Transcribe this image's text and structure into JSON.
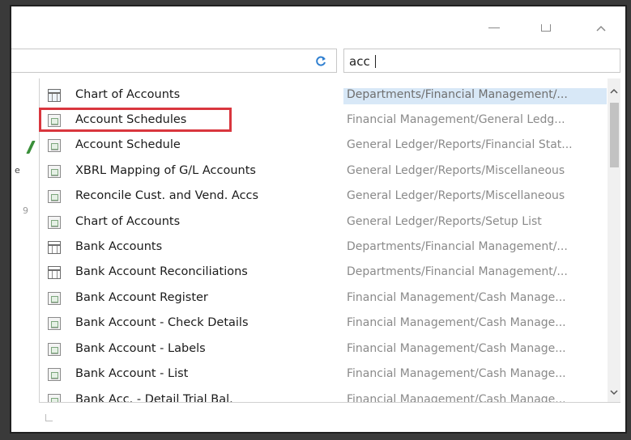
{
  "search": {
    "value": "acc"
  },
  "icons": {
    "minimize": "minimize-icon",
    "maximize": "maximize-icon",
    "collapse": "chevron-up-icon",
    "refresh": "refresh-icon",
    "scroll_up": "chevron-up-icon",
    "scroll_down": "chevron-down-icon"
  },
  "background_fragments": [
    "e",
    "9"
  ],
  "results": [
    {
      "name": "Chart of Accounts",
      "path": "Departments/Financial Management/...",
      "icon": "table-icon",
      "selected": true
    },
    {
      "name": "Account Schedules",
      "path": "Financial Management/General Ledg...",
      "icon": "report-icon",
      "selected": false,
      "highlighted": true
    },
    {
      "name": "Account Schedule",
      "path": "General Ledger/Reports/Financial Stat...",
      "icon": "report-icon",
      "selected": false
    },
    {
      "name": "XBRL Mapping of G/L Accounts",
      "path": "General Ledger/Reports/Miscellaneous",
      "icon": "report-icon",
      "selected": false
    },
    {
      "name": "Reconcile Cust. and Vend. Accs",
      "path": "General Ledger/Reports/Miscellaneous",
      "icon": "report-icon",
      "selected": false
    },
    {
      "name": "Chart of Accounts",
      "path": "General Ledger/Reports/Setup List",
      "icon": "report-icon",
      "selected": false
    },
    {
      "name": "Bank Accounts",
      "path": "Departments/Financial Management/...",
      "icon": "table-icon",
      "selected": false
    },
    {
      "name": "Bank Account Reconciliations",
      "path": "Departments/Financial Management/...",
      "icon": "table-icon",
      "selected": false
    },
    {
      "name": "Bank Account Register",
      "path": "Financial Management/Cash Manage...",
      "icon": "report-icon",
      "selected": false
    },
    {
      "name": "Bank Account - Check Details",
      "path": "Financial Management/Cash Manage...",
      "icon": "report-icon",
      "selected": false
    },
    {
      "name": "Bank Account - Labels",
      "path": "Financial Management/Cash Manage...",
      "icon": "report-icon",
      "selected": false
    },
    {
      "name": "Bank Account - List",
      "path": "Financial Management/Cash Manage...",
      "icon": "report-icon",
      "selected": false
    },
    {
      "name": "Bank Acc. - Detail Trial Bal.",
      "path": "Financial Management/Cash Manage...",
      "icon": "report-icon",
      "selected": false
    }
  ],
  "colors": {
    "selection": "#d8e8f7",
    "highlight_border": "#d9363e",
    "refresh_icon": "#2f7fd0"
  }
}
